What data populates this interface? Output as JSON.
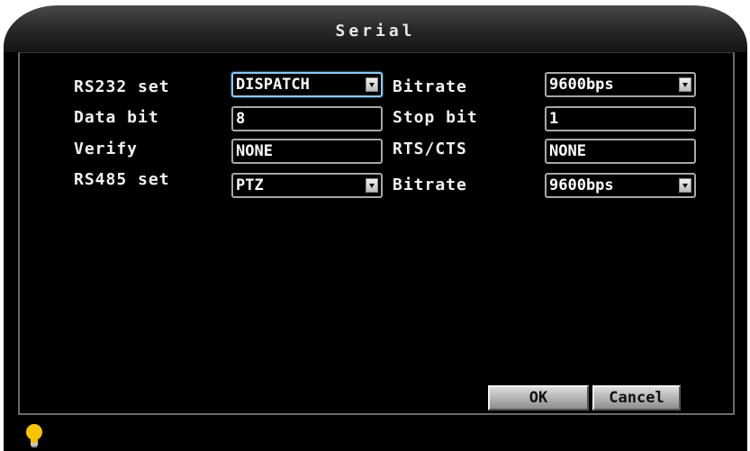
{
  "window": {
    "title": "Serial"
  },
  "rows": {
    "rs232_set": {
      "label": "RS232 set",
      "value": "DISPATCH"
    },
    "bitrate_1": {
      "label": "Bitrate",
      "value": "9600bps"
    },
    "data_bit": {
      "label": "Data bit",
      "value": "8"
    },
    "stop_bit": {
      "label": "Stop bit",
      "value": "1"
    },
    "verify": {
      "label": "Verify",
      "value": "NONE"
    },
    "rts_cts": {
      "label": "RTS/CTS",
      "value": "NONE"
    },
    "rs485_set": {
      "label": "RS485 set",
      "value": "PTZ"
    },
    "bitrate_2": {
      "label": "Bitrate",
      "value": "9600bps"
    }
  },
  "buttons": {
    "ok": "OK",
    "cancel": "Cancel"
  },
  "icons": {
    "status": "lightbulb-icon"
  },
  "colors": {
    "focus_border": "#8ec9f0",
    "panel_bg": "#000000",
    "bulb": "#f5c400"
  }
}
